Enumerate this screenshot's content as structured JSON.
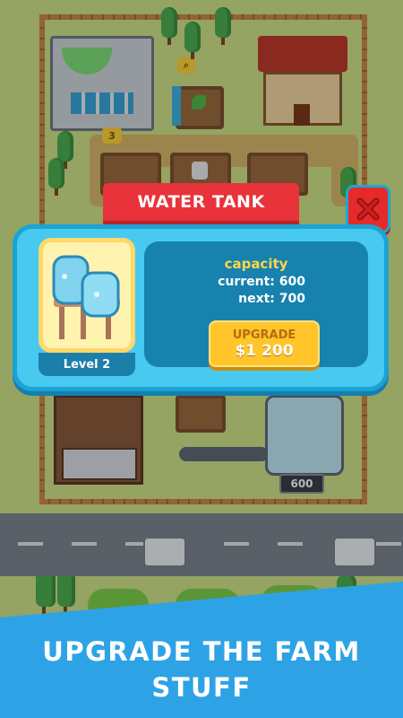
{
  "modal": {
    "title": "WATER TANK",
    "level": "Level 2",
    "capacity_label": "capacity",
    "current_line": "current: 600",
    "next_line": "next: 700",
    "upgrade_label": "UPGRADE",
    "upgrade_price": "$1 200"
  },
  "farm": {
    "tank_capacity_sign": "600",
    "badge_3": "3"
  },
  "promo": {
    "line1": "UPGRADE THE FARM",
    "line2": "STUFF"
  },
  "icons": {
    "close": "close-x-icon",
    "water_tank": "water-tank-icon",
    "lock": "lock-icon",
    "search": "magnifier-icon"
  },
  "colors": {
    "banner": "#e8333a",
    "panel": "#47c9f0",
    "upgrade_button": "#ffc52a",
    "footer": "#2da3e6"
  }
}
